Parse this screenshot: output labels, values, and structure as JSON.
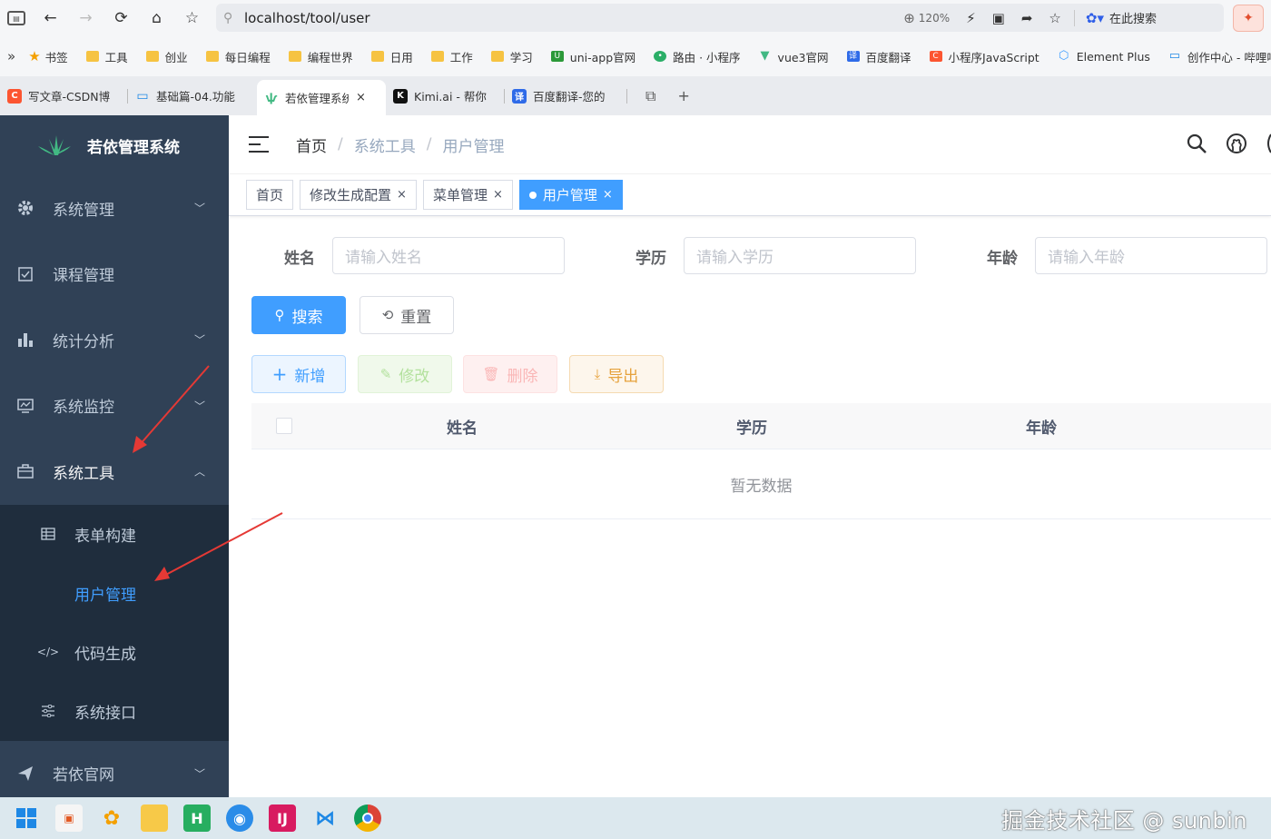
{
  "browser": {
    "url": "localhost/tool/user",
    "zoom": "120%",
    "search_hint": "在此搜索",
    "bookmarks": [
      {
        "label": "书签",
        "icon": "star-icon"
      },
      {
        "label": "工具",
        "icon": "folder-icon"
      },
      {
        "label": "创业",
        "icon": "folder-icon"
      },
      {
        "label": "每日编程",
        "icon": "folder-icon"
      },
      {
        "label": "编程世界",
        "icon": "folder-icon"
      },
      {
        "label": "日用",
        "icon": "folder-icon"
      },
      {
        "label": "工作",
        "icon": "folder-icon"
      },
      {
        "label": "学习",
        "icon": "folder-icon"
      },
      {
        "label": "uni-app官网",
        "icon": "uniapp-icon"
      },
      {
        "label": "路由 · 小程序",
        "icon": "wechat-icon"
      },
      {
        "label": "vue3官网",
        "icon": "vue-icon"
      },
      {
        "label": "百度翻译",
        "icon": "translate-icon"
      },
      {
        "label": "小程序JavaScript",
        "icon": "csdn-icon"
      },
      {
        "label": "Element Plus",
        "icon": "element-icon"
      },
      {
        "label": "创作中心 - 哔哩哔",
        "icon": "bilibili-icon"
      }
    ],
    "tabs": [
      {
        "label": "写文章-CSDN博",
        "icon": "csdn-icon",
        "active": false
      },
      {
        "label": "基础篇-04.功能",
        "icon": "bilibili-icon",
        "active": false
      },
      {
        "label": "若依管理系统",
        "icon": "ruoyi-icon",
        "active": true
      },
      {
        "label": "Kimi.ai - 帮你",
        "icon": "kimi-icon",
        "active": false
      },
      {
        "label": "百度翻译-您的",
        "icon": "translate-icon",
        "active": false
      }
    ],
    "tab_close": "×",
    "new_tab": "+"
  },
  "sidebar": {
    "logo_text": "若依管理系统",
    "menu": [
      {
        "label": "系统管理",
        "icon": "gear-icon",
        "arrow": "down"
      },
      {
        "label": "课程管理",
        "icon": "checkbox-icon",
        "arrow": ""
      },
      {
        "label": "统计分析",
        "icon": "chart-icon",
        "arrow": "down"
      },
      {
        "label": "系统监控",
        "icon": "monitor-icon",
        "arrow": "down"
      },
      {
        "label": "系统工具",
        "icon": "toolbox-icon",
        "arrow": "up"
      }
    ],
    "submenu": [
      {
        "label": "表单构建",
        "icon": "table-icon",
        "active": false
      },
      {
        "label": "用户管理",
        "icon": "",
        "active": true
      },
      {
        "label": "代码生成",
        "icon": "code-icon",
        "active": false
      },
      {
        "label": "系统接口",
        "icon": "sliders-icon",
        "active": false
      }
    ],
    "bottom_item": {
      "label": "若依官网",
      "icon": "send-icon",
      "arrow": "down"
    }
  },
  "navbar": {
    "breadcrumb": [
      "首页",
      "系统工具",
      "用户管理"
    ],
    "separator": "/"
  },
  "tags": [
    {
      "label": "首页",
      "closable": false,
      "active": false
    },
    {
      "label": "修改生成配置",
      "closable": true,
      "active": false
    },
    {
      "label": "菜单管理",
      "closable": true,
      "active": false
    },
    {
      "label": "用户管理",
      "closable": true,
      "active": true
    }
  ],
  "tag_close": "×",
  "search_form": {
    "name_label": "姓名",
    "name_placeholder": "请输入姓名",
    "edu_label": "学历",
    "edu_placeholder": "请输入学历",
    "age_label": "年龄",
    "age_placeholder": "请输入年龄",
    "search_btn": "搜索",
    "reset_btn": "重置"
  },
  "toolbar": {
    "add": "新增",
    "edit": "修改",
    "delete": "删除",
    "export": "导出"
  },
  "table": {
    "columns": [
      "姓名",
      "学历",
      "年龄"
    ],
    "empty_text": "暂无数据"
  },
  "watermark": "掘金技术社区 @ sunbin",
  "colors": {
    "sidebar_bg": "#304156",
    "submenu_bg": "#1f2d3d",
    "primary": "#409eff",
    "annotation_arrow": "#e53935"
  }
}
